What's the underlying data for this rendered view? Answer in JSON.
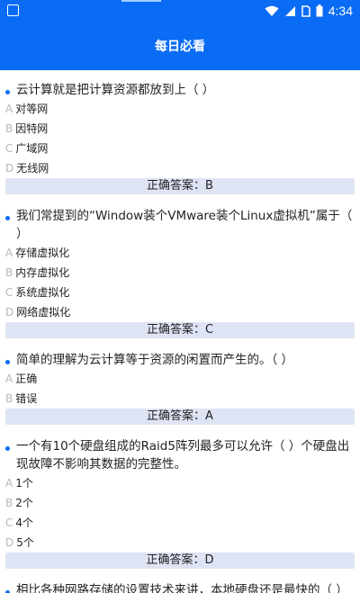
{
  "status_bar": {
    "time": "4:34",
    "icons": [
      "wifi-icon",
      "signal-icon",
      "sim-icon",
      "battery-icon"
    ]
  },
  "app_bar": {
    "title": "每日必看"
  },
  "questions": [
    {
      "text": "云计算就是把计算资源都放到上（ ）",
      "options": [
        {
          "letter": "A",
          "text": "对等网"
        },
        {
          "letter": "B",
          "text": "因特网"
        },
        {
          "letter": "C",
          "text": "广域网"
        },
        {
          "letter": "D",
          "text": "无线网"
        }
      ],
      "answer": "正确答案：B"
    },
    {
      "text": "我们常提到的“Window装个VMware装个Linux虚拟机”属于（ ）",
      "options": [
        {
          "letter": "A",
          "text": "存储虚拟化"
        },
        {
          "letter": "B",
          "text": "内存虚拟化"
        },
        {
          "letter": "C",
          "text": "系统虚拟化"
        },
        {
          "letter": "D",
          "text": "网络虚拟化"
        }
      ],
      "answer": "正确答案：C"
    },
    {
      "text": "简单的理解为云计算等于资源的闲置而产生的。（ ）",
      "options": [
        {
          "letter": "A",
          "text": "正确"
        },
        {
          "letter": "B",
          "text": "错误"
        }
      ],
      "answer": "正确答案：A"
    },
    {
      "text": "一个有10个硬盘组成的Raid5阵列最多可以允许（ ）个硬盘出现故障不影响其数据的完整性。",
      "options": [
        {
          "letter": "A",
          "text": "1个"
        },
        {
          "letter": "B",
          "text": "2个"
        },
        {
          "letter": "C",
          "text": "4个"
        },
        {
          "letter": "D",
          "text": "5个"
        }
      ],
      "answer": "正确答案：D"
    },
    {
      "text": "相比各种网路存储的设置技术来讲，本地硬盘还是最快的（ ）",
      "options": [],
      "answer": ""
    }
  ],
  "colors": {
    "primary": "#0a6cf5",
    "answer_bg": "#dfe4f5"
  }
}
